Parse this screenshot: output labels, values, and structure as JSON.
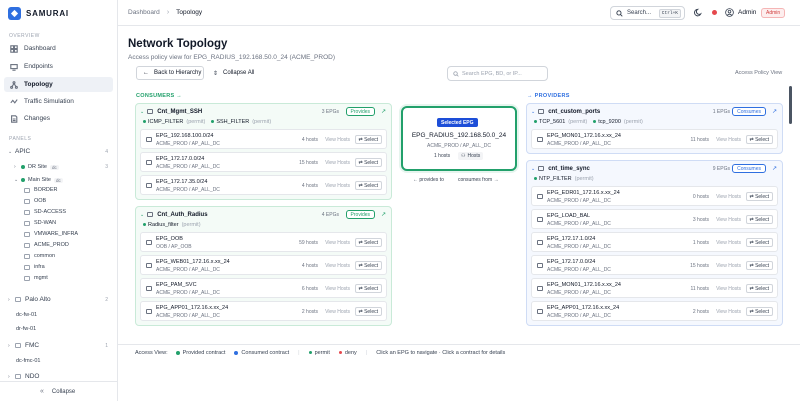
{
  "app": {
    "name": "SAMURAI"
  },
  "sidebar": {
    "overview_label": "OVERVIEW",
    "panels_label": "PANELS",
    "nav": [
      {
        "label": "Dashboard",
        "icon": "dashboard-icon"
      },
      {
        "label": "Endpoints",
        "icon": "endpoints-icon"
      },
      {
        "label": "Topology",
        "icon": "topology-icon",
        "active": true
      },
      {
        "label": "Traffic Simulation",
        "icon": "simulation-icon"
      },
      {
        "label": "Changes",
        "icon": "changes-icon"
      }
    ],
    "apic": {
      "label": "APIC",
      "count": "4"
    },
    "dr_site": {
      "label": "DR Site",
      "badge": "dc",
      "count": "3"
    },
    "main_site": {
      "label": "Main Site",
      "badge": "dc"
    },
    "tenants": [
      "BORDER",
      "OOB",
      "SD-ACCESS",
      "SD-WAN",
      "VMWARE_INFRA",
      "ACME_PROD",
      "common",
      "infra",
      "mgmt"
    ],
    "palo_alto": {
      "label": "Palo Alto",
      "count": "2"
    },
    "palo_items": [
      "dc-fw-01",
      "dr-fw-01"
    ],
    "fmc": {
      "label": "FMC",
      "count": "1"
    },
    "fmc_items": [
      "dc-fmc-01"
    ],
    "ndo": {
      "label": "NDO"
    },
    "collapse_label": "Collapse"
  },
  "topbar": {
    "breadcrumb": [
      "Dashboard",
      "Topology"
    ],
    "search_label": "Search...",
    "shortcut": "Ctrl+K",
    "user": "Admin",
    "role": "Admin"
  },
  "page": {
    "title": "Network Topology",
    "subtitle": "Access policy view for EPG_RADIUS_192.168.50.0_24 (ACME_PROD)",
    "back_label": "Back to Hierarchy",
    "collapse_all_label": "Collapse All",
    "search_placeholder": "Search EPG, BD, or IP...",
    "view_label": "Access Policy View"
  },
  "consumers_label": "CONSUMERS →",
  "providers_label": "→ PROVIDERS",
  "consumers": [
    {
      "name": "Cnt_Mgmt_SSH",
      "count": "3 EPGs",
      "type": "Provides",
      "filters": [
        {
          "name": "ICMP_FILTER",
          "perm": "(permit)"
        },
        {
          "name": "SSH_FILTER",
          "perm": "(permit)"
        }
      ],
      "epgs": [
        {
          "name": "EPG_192.168.100.0/24",
          "path": "ACME_PROD / AP_ALL_DC",
          "hosts": "4 hosts"
        },
        {
          "name": "EPG_172.17.0.0/24",
          "path": "ACME_PROD / AP_ALL_DC",
          "hosts": "15 hosts"
        },
        {
          "name": "EPG_172.17.35.0/24",
          "path": "ACME_PROD / AP_ALL_DC",
          "hosts": "4 hosts"
        }
      ]
    },
    {
      "name": "Cnt_Auth_Radius",
      "count": "4 EPGs",
      "type": "Provides",
      "filters": [
        {
          "name": "Radius_filter",
          "perm": "(permit)"
        }
      ],
      "epgs": [
        {
          "name": "EPG_OOB",
          "path": "OOB / AP_OOB",
          "hosts": "59 hosts"
        },
        {
          "name": "EPG_WEB01_172.16.x.xx_24",
          "path": "ACME_PROD / AP_ALL_DC",
          "hosts": "4 hosts"
        },
        {
          "name": "EPG_PAM_SVC",
          "path": "ACME_PROD / AP_ALL_DC",
          "hosts": "6 hosts"
        },
        {
          "name": "EPG_APP01_172.16.x.xx_24",
          "path": "ACME_PROD / AP_ALL_DC",
          "hosts": "2 hosts"
        }
      ]
    }
  ],
  "providers": [
    {
      "name": "cnt_custom_ports",
      "count": "1 EPGs",
      "type": "Consumes",
      "filters": [
        {
          "name": "TCP_5601",
          "perm": "(permit)"
        },
        {
          "name": "tcp_9200",
          "perm": "(permit)"
        }
      ],
      "epgs": [
        {
          "name": "EPG_MON01_172.16.x.xx_24",
          "path": "ACME_PROD / AP_ALL_DC",
          "hosts": "11 hosts"
        }
      ]
    },
    {
      "name": "cnt_time_sync",
      "count": "9 EPGs",
      "type": "Consumes",
      "filters": [
        {
          "name": "NTP_FILTER",
          "perm": "(permit)"
        }
      ],
      "epgs": [
        {
          "name": "EPG_EDR01_172.16.x.xx_24",
          "path": "ACME_PROD / AP_ALL_DC",
          "hosts": "0 hosts"
        },
        {
          "name": "EPG_LOAD_BAL",
          "path": "ACME_PROD / AP_ALL_DC",
          "hosts": "3 hosts"
        },
        {
          "name": "EPG_172.17.1.0/24",
          "path": "ACME_PROD / AP_ALL_DC",
          "hosts": "1 hosts"
        },
        {
          "name": "EPG_172.17.0.0/24",
          "path": "ACME_PROD / AP_ALL_DC",
          "hosts": "15 hosts"
        },
        {
          "name": "EPG_MON01_172.16.x.xx_24",
          "path": "ACME_PROD / AP_ALL_DC",
          "hosts": "11 hosts"
        },
        {
          "name": "EPG_APP01_172.16.x.xx_24",
          "path": "ACME_PROD / AP_ALL_DC",
          "hosts": "2 hosts"
        }
      ]
    }
  ],
  "epg_actions": {
    "view": "View Hosts",
    "select": "⇄ Select"
  },
  "selected": {
    "badge": "Selected EPG",
    "name": "EPG_RADIUS_192.168.50.0_24",
    "path": "ACME_PROD / AP_ALL_DC",
    "hosts": "1 hosts",
    "hosts_btn": "Hosts",
    "provides_to": "← provides to",
    "consumes_from": "consumes from →"
  },
  "legend": {
    "label": "Access View:",
    "provided": "Provided contract",
    "consumed": "Consumed contract",
    "permit": "permit",
    "deny": "deny",
    "hint": "Click an EPG to navigate · Click a contract for details"
  },
  "colors": {
    "accent": "#2f6fe0",
    "provided": "#22a06b",
    "consumed": "#2f6fe0",
    "deny": "#e5484d",
    "admin": "#d13f3f"
  }
}
